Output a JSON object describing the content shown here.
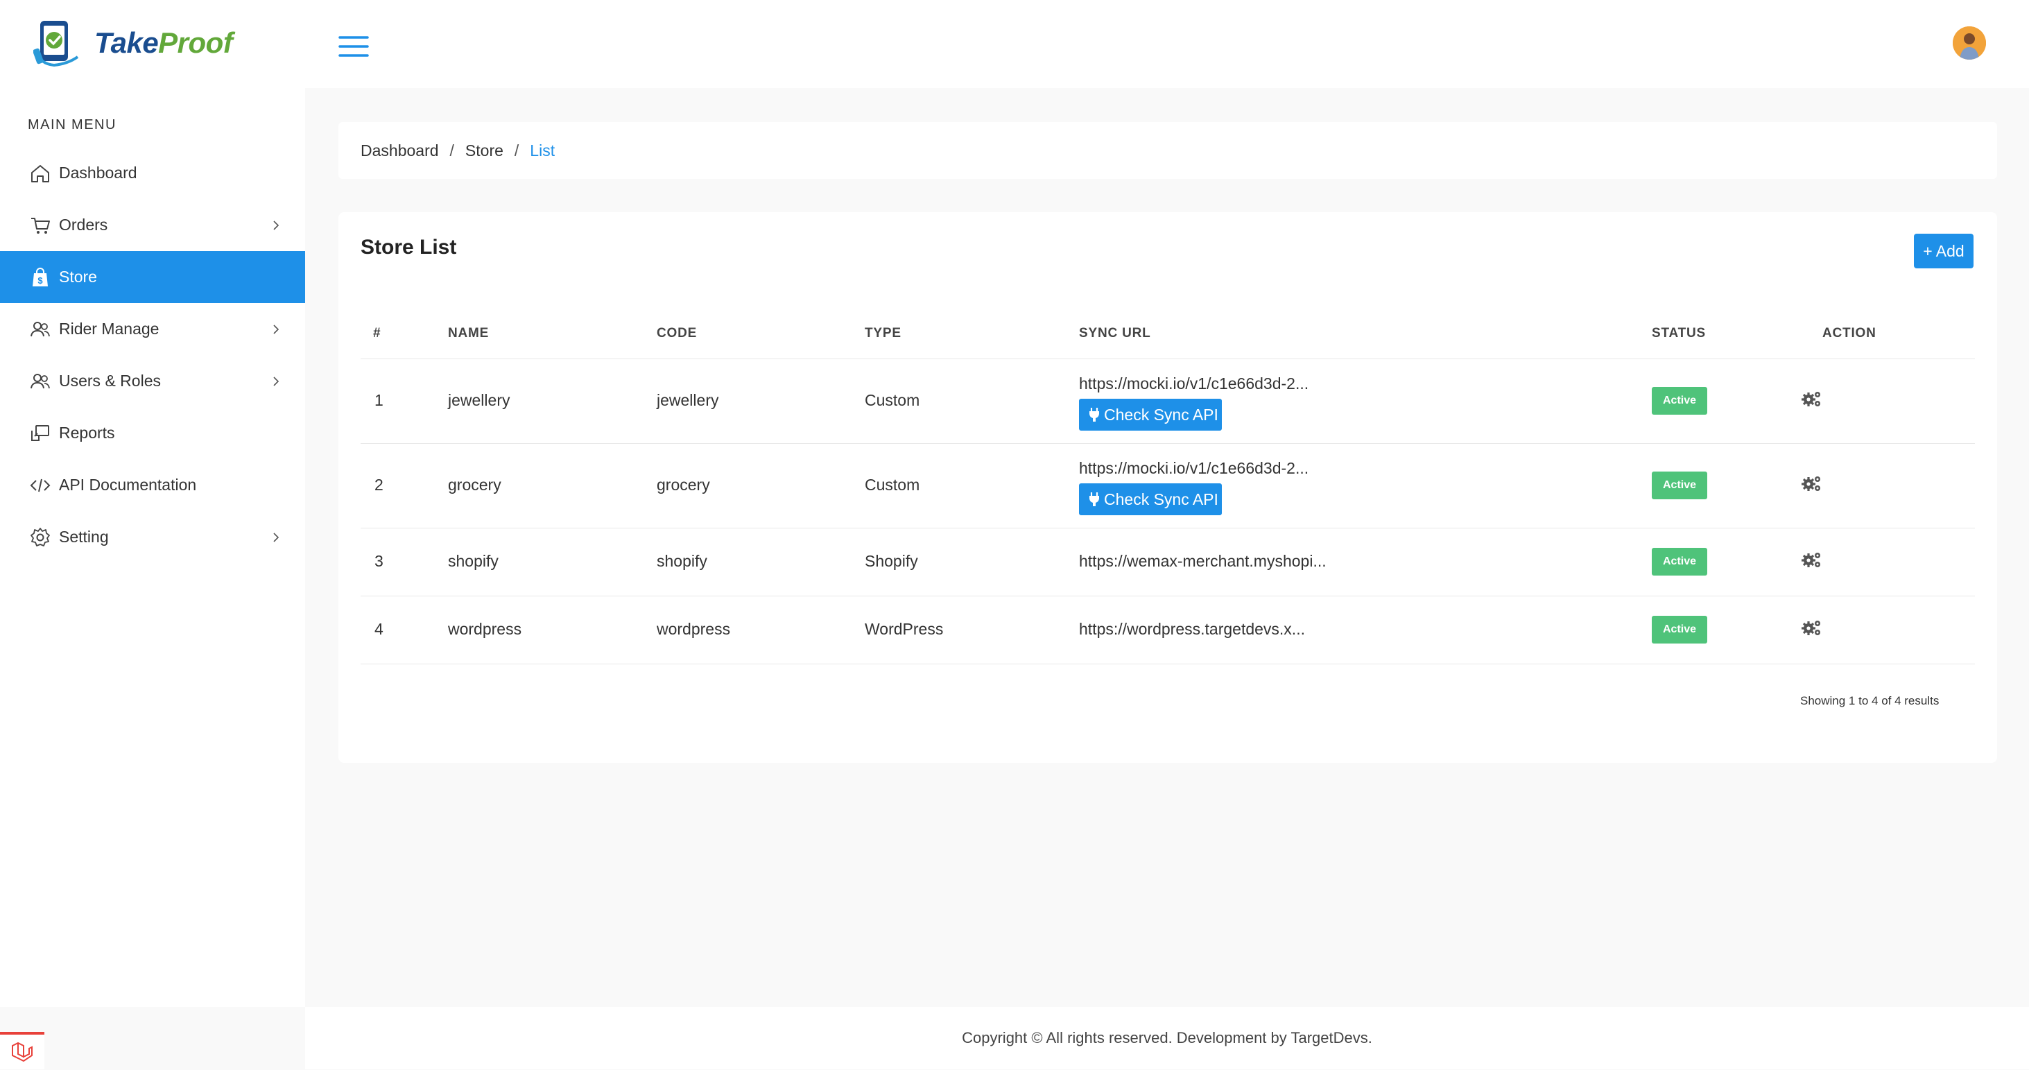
{
  "brand": {
    "name_part1": "Take",
    "name_part2": "Proof"
  },
  "sidebar": {
    "menu_title": "MAIN MENU",
    "items": [
      {
        "label": "Dashboard",
        "icon": "home-icon",
        "has_submenu": false
      },
      {
        "label": "Orders",
        "icon": "cart-icon",
        "has_submenu": true
      },
      {
        "label": "Store",
        "icon": "shopping-bag-icon",
        "has_submenu": false,
        "active": true
      },
      {
        "label": "Rider Manage",
        "icon": "users-icon",
        "has_submenu": true
      },
      {
        "label": "Users & Roles",
        "icon": "users-icon",
        "has_submenu": true
      },
      {
        "label": "Reports",
        "icon": "reports-icon",
        "has_submenu": false
      },
      {
        "label": "API Documentation",
        "icon": "code-icon",
        "has_submenu": false
      },
      {
        "label": "Setting",
        "icon": "gear-icon",
        "has_submenu": true
      }
    ]
  },
  "breadcrumb": {
    "items": [
      "Dashboard",
      "Store",
      "List"
    ],
    "separator": "/"
  },
  "store_list": {
    "title": "Store List",
    "add_label": "+ Add",
    "columns": [
      "#",
      "NAME",
      "CODE",
      "TYPE",
      "SYNC URL",
      "STATUS",
      "ACTION"
    ],
    "rows": [
      {
        "index": "1",
        "name": "jewellery",
        "code": "jewellery",
        "type": "Custom",
        "sync_url": "https://mocki.io/v1/c1e66d3d-2...",
        "check_label": "Check Sync API",
        "status": "Active"
      },
      {
        "index": "2",
        "name": "grocery",
        "code": "grocery",
        "type": "Custom",
        "sync_url": "https://mocki.io/v1/c1e66d3d-2...",
        "check_label": "Check Sync API",
        "status": "Active"
      },
      {
        "index": "3",
        "name": "shopify",
        "code": "shopify",
        "type": "Shopify",
        "sync_url": "https://wemax-merchant.myshopi...",
        "status": "Active"
      },
      {
        "index": "4",
        "name": "wordpress",
        "code": "wordpress",
        "type": "WordPress",
        "sync_url": "https://wordpress.targetdevs.x...",
        "status": "Active"
      }
    ],
    "showing": "Showing 1 to 4 of 4 results"
  },
  "footer": {
    "text": "Copyright © All rights reserved. Development by TargetDevs."
  },
  "colors": {
    "accent": "#1e90e8",
    "active_badge": "#4fc37a",
    "logo_blue": "#1a4d8f",
    "logo_green": "#62a83a"
  }
}
